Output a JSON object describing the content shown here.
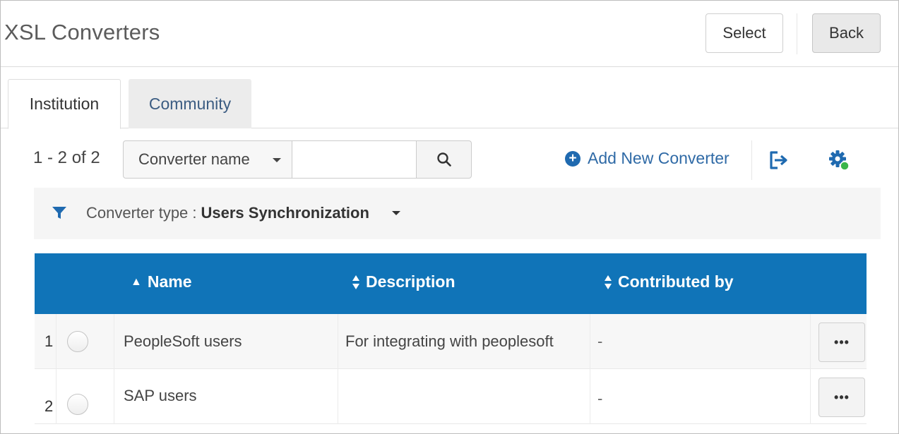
{
  "header": {
    "title": "XSL Converters",
    "select_label": "Select",
    "back_label": "Back"
  },
  "tabs": [
    {
      "label": "Institution",
      "active": true
    },
    {
      "label": "Community",
      "active": false
    }
  ],
  "toolbar": {
    "count": "1 - 2 of 2",
    "search_scope": "Converter name",
    "search_value": "",
    "add_label": "Add New Converter",
    "icons": [
      "search-icon",
      "export-icon",
      "gear-icon"
    ]
  },
  "filter": {
    "label": "Converter type :",
    "value": "Users Synchronization"
  },
  "table": {
    "headers": [
      "Name",
      "Description",
      "Contributed by"
    ],
    "rows": [
      {
        "num": "1",
        "name": "PeopleSoft users",
        "description": "For integrating with peoplesoft",
        "contributed_by": "-",
        "more": "•••"
      },
      {
        "num": "2",
        "name": "SAP users",
        "description": "",
        "contributed_by": "-",
        "more": "•••"
      }
    ]
  },
  "colors": {
    "table_header": "#1074b8",
    "link": "#2f6aa6",
    "status_dot": "#3ab54a"
  }
}
